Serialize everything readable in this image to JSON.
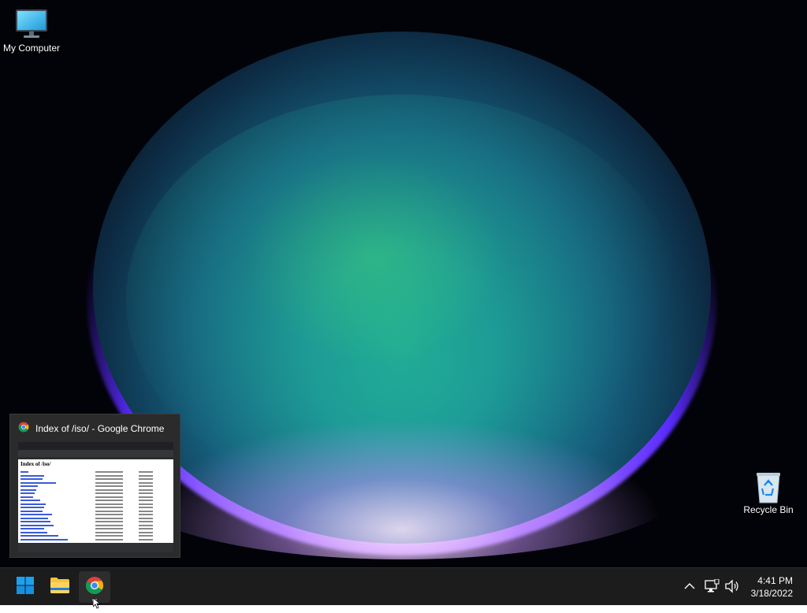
{
  "desktop": {
    "icons": [
      {
        "label": "My Computer",
        "icon": "monitor-icon"
      },
      {
        "label": "Recycle Bin",
        "icon": "recycle-bin-icon"
      }
    ]
  },
  "preview": {
    "title": "Index of /iso/ - Google Chrome",
    "page_heading": "Index of /iso/"
  },
  "taskbar": {
    "apps": [
      {
        "name": "Start",
        "icon": "windows-start-icon"
      },
      {
        "name": "File Explorer",
        "icon": "folder-icon"
      },
      {
        "name": "Google Chrome",
        "icon": "chrome-icon",
        "active": true
      }
    ],
    "tray": [
      "chevron-up-icon",
      "network-icon",
      "volume-icon"
    ],
    "clock": {
      "time": "4:41 PM",
      "date": "3/18/2022"
    }
  },
  "colors": {
    "taskbar_bg": "#1c1c1c",
    "windows_blue": "#0a84e0",
    "folder_yellow": "#f4c242"
  }
}
